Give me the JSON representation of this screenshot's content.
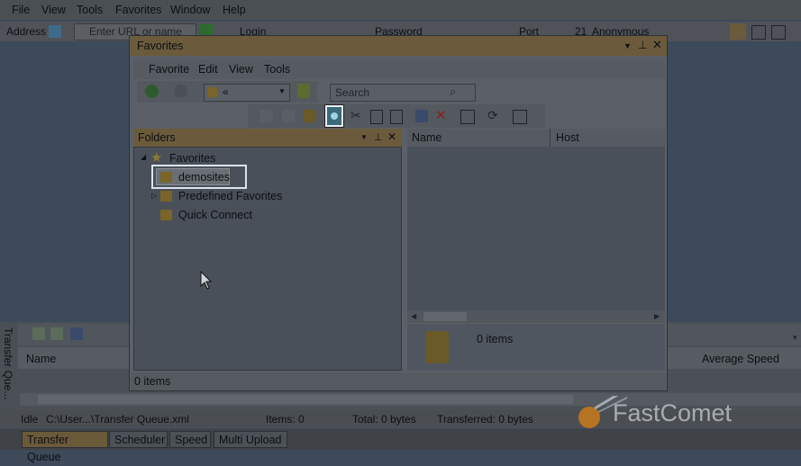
{
  "menu": {
    "file": "File",
    "view": "View",
    "tools": "Tools",
    "favorites": "Favorites",
    "window": "Window",
    "help": "Help"
  },
  "address": {
    "label": "Address",
    "placeholder": "Enter URL or name",
    "login": "Login",
    "password": "Password",
    "port": "Port",
    "port_value": "21",
    "anonymous": "Anonymous"
  },
  "favwin": {
    "title": "Favorites",
    "menu": {
      "favorite": "Favorite",
      "edit": "Edit",
      "view": "View",
      "tools": "Tools"
    },
    "nav_value": "«",
    "search_placeholder": "Search",
    "folders_title": "Folders",
    "tree": {
      "root": "Favorites",
      "selected": "demosites",
      "predefined": "Predefined Favorites",
      "quick": "Quick Connect"
    },
    "columns": {
      "name": "Name",
      "host": "Host"
    },
    "preview_items": "0 items",
    "status": "0 items"
  },
  "queue": {
    "side_tab": "Transfer Que...",
    "columns": {
      "name": "Name",
      "avg_speed": "Average Speed"
    }
  },
  "status": {
    "idle": "Idle",
    "file": "C:\\User...\\Transfer Queue.xml",
    "items": "Items: 0",
    "total": "Total: 0 bytes",
    "transferred": "Transferred: 0 bytes"
  },
  "tabs": [
    "Transfer Queue",
    "Scheduler",
    "Speed",
    "Multi Upload"
  ],
  "logo": {
    "text": "FastComet"
  },
  "colors": {
    "accent": "#6b5b3c",
    "highlight": "#e9eef3"
  }
}
